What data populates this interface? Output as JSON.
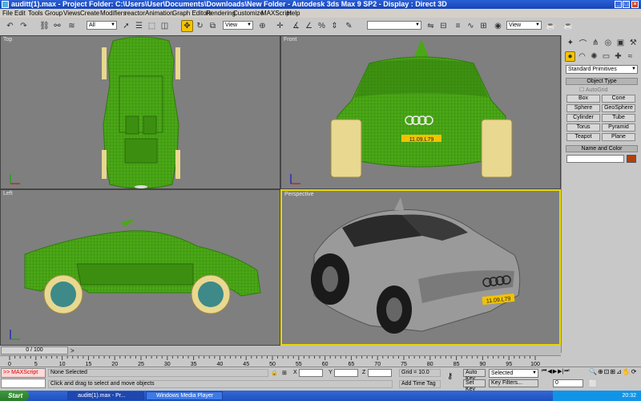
{
  "window": {
    "title": "auditt(1).max - Project Folder: C:\\Users\\User\\Documents\\Downloads\\New Folder - Autodesk 3ds Max 9 SP2 - Display : Direct 3D"
  },
  "menu": [
    "File",
    "Edit",
    "Tools",
    "Group",
    "Views",
    "Create",
    "Modifiers",
    "reactor",
    "Animation",
    "Graph Editors",
    "Rendering",
    "Customize",
    "MAXScript",
    "Help"
  ],
  "toolbar": {
    "selection_filter": "All",
    "ref_coord": "View",
    "named_sel": "",
    "render_view": "View"
  },
  "viewports": {
    "top": {
      "label": "Top"
    },
    "front": {
      "label": "Front"
    },
    "left": {
      "label": "Left"
    },
    "perspective": {
      "label": "Perspective"
    },
    "plate": "11.09.L79",
    "colors": {
      "wire": "#4aa816",
      "wire_dark": "#2f7a0c",
      "viewport_bg": "#7f7f7f",
      "active_border": "#e8d800"
    }
  },
  "command_panel": {
    "category_dropdown": "Standard Primitives",
    "object_type_header": "Object Type",
    "autogrid": "AutoGrid",
    "primitives": [
      "Box",
      "Cone",
      "Sphere",
      "GeoSphere",
      "Cylinder",
      "Tube",
      "Torus",
      "Pyramid",
      "Teapot",
      "Plane"
    ],
    "name_color_header": "Name and Color",
    "object_color": "#b04010"
  },
  "timeline": {
    "frame_label": "0 / 100",
    "ticks": [
      "0",
      "5",
      "10",
      "15",
      "20",
      "25",
      "30",
      "35",
      "40",
      "45",
      "50",
      "55",
      "60",
      "65",
      "70",
      "75",
      "80",
      "85",
      "90",
      "95",
      "100"
    ]
  },
  "status": {
    "maxscript_label": "MAXScript",
    "selection_text": "None Selected",
    "prompt_text": "Click and drag to select and move objects",
    "x_label": "X",
    "y_label": "Y",
    "z_label": "Z",
    "grid": "Grid = 10.0",
    "add_time_tag": "Add Time Tag",
    "auto_key": "Auto Key",
    "set_key": "Set Key",
    "key_mode_value": "Selected",
    "key_filters": "Key Filters...",
    "current_frame": "0"
  },
  "taskbar": {
    "start": "Start",
    "tasks": [
      "auditt(1).max - Pr...",
      "Windows Media Player"
    ],
    "clock": "20:32"
  }
}
